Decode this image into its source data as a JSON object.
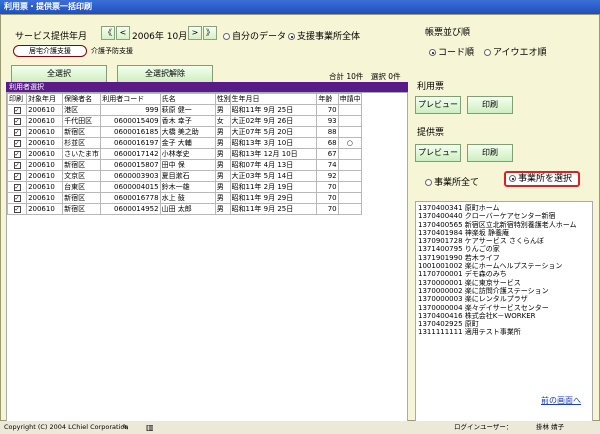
{
  "window_title": "利用票・提供票一括印刷",
  "service_period": {
    "label": "サービス提供年月",
    "first_btn": "《",
    "prev_btn": "<",
    "year_month": "2006年 10月",
    "next_btn": ">",
    "last_btn": "》"
  },
  "scope": {
    "own": "自分のデータ",
    "all": "支援事業所全体",
    "selected": "all"
  },
  "tabs": [
    "居宅介護支援",
    "介護予防支援"
  ],
  "buttons": {
    "select_all": "全選択",
    "deselect_all": "全選択解除"
  },
  "totals": "合計 10件　選択 0件",
  "grid_title": "利用者選択",
  "columns": [
    "印刷",
    "対象年月",
    "保険者名",
    "利用者コード",
    "氏名",
    "性別",
    "生年月日",
    "年齢",
    "申請中"
  ],
  "rows": [
    {
      "month": "200610",
      "insurer": "港区",
      "code": "999",
      "name": "萩原 健一",
      "sex": "男",
      "birth": "昭和11年 9月 25日",
      "age": "70",
      "pending": ""
    },
    {
      "month": "200610",
      "insurer": "千代田区",
      "code": "0600015409",
      "name": "香木 幸子",
      "sex": "女",
      "birth": "大正02年 9月 26日",
      "age": "93",
      "pending": ""
    },
    {
      "month": "200610",
      "insurer": "新宿区",
      "code": "0600016185",
      "name": "大橋 美之助",
      "sex": "男",
      "birth": "大正07年 5月 20日",
      "age": "88",
      "pending": ""
    },
    {
      "month": "200610",
      "insurer": "杉並区",
      "code": "0600016197",
      "name": "金子 大輔",
      "sex": "男",
      "birth": "昭和13年 3月 10日",
      "age": "68",
      "pending": "○"
    },
    {
      "month": "200610",
      "insurer": "さいたま市",
      "code": "0600017142",
      "name": "小林孝史",
      "sex": "男",
      "birth": "昭和13年 12月 10日",
      "age": "67",
      "pending": ""
    },
    {
      "month": "200610",
      "insurer": "新宿区",
      "code": "0600015807",
      "name": "田中 保",
      "sex": "男",
      "birth": "昭和07年 4月 13日",
      "age": "74",
      "pending": ""
    },
    {
      "month": "200610",
      "insurer": "文京区",
      "code": "0600003903",
      "name": "夏目漱石",
      "sex": "男",
      "birth": "大正03年 5月 14日",
      "age": "92",
      "pending": ""
    },
    {
      "month": "200610",
      "insurer": "台東区",
      "code": "0600004015",
      "name": "鈴木一雄",
      "sex": "男",
      "birth": "昭和11年 2月 19日",
      "age": "70",
      "pending": ""
    },
    {
      "month": "200610",
      "insurer": "新宿区",
      "code": "0600016778",
      "name": "水上 鼓",
      "sex": "男",
      "birth": "昭和11年 9月 29日",
      "age": "70",
      "pending": ""
    },
    {
      "month": "200610",
      "insurer": "新宿区",
      "code": "0600014952",
      "name": "山田 太郎",
      "sex": "男",
      "birth": "昭和11年 9月 25日",
      "age": "70",
      "pending": ""
    }
  ],
  "sort": {
    "label": "帳票並び順",
    "code": "コード順",
    "kana": "アイウエオ順",
    "selected": "code"
  },
  "usage_ticket": {
    "label": "利用票",
    "preview": "プレビュー",
    "print": "印刷"
  },
  "provision_ticket": {
    "label": "提供票",
    "preview": "プレビュー",
    "print": "印刷"
  },
  "office_scope": {
    "all": "事業所全て",
    "select": "事業所を選択",
    "selected": "select"
  },
  "offices": [
    "1370400341 原町ホーム",
    "1370400440 クローバーケアセンター新宿",
    "1370400565 新宿区立北新宿特別養護老人ホーム",
    "1370401984 神楽坂 静養庵",
    "1370901728 ケアサービス さくらんぼ",
    "1371400795 りんごの家",
    "1371901990 若木ライフ",
    "1001001002 楽にホームヘルプステーション",
    "1170700001 デモ森のみち",
    "1370000001 楽に東京サービス",
    "1370000002 楽に訪問介護ステーション",
    "1370000003 楽にレンタルプラザ",
    "1370000004 楽々デイサービスセンター",
    "1370400416 株式会社K－WORKER",
    "1370402925 原町",
    "1311111111 適用テスト事業所"
  ],
  "back_link": "前の画面へ",
  "status": {
    "copyright": "Copyright (C) 2004 LChiel Corporation",
    "login_label": "ログインユーザー：",
    "login_user": "掛林 婧子"
  }
}
